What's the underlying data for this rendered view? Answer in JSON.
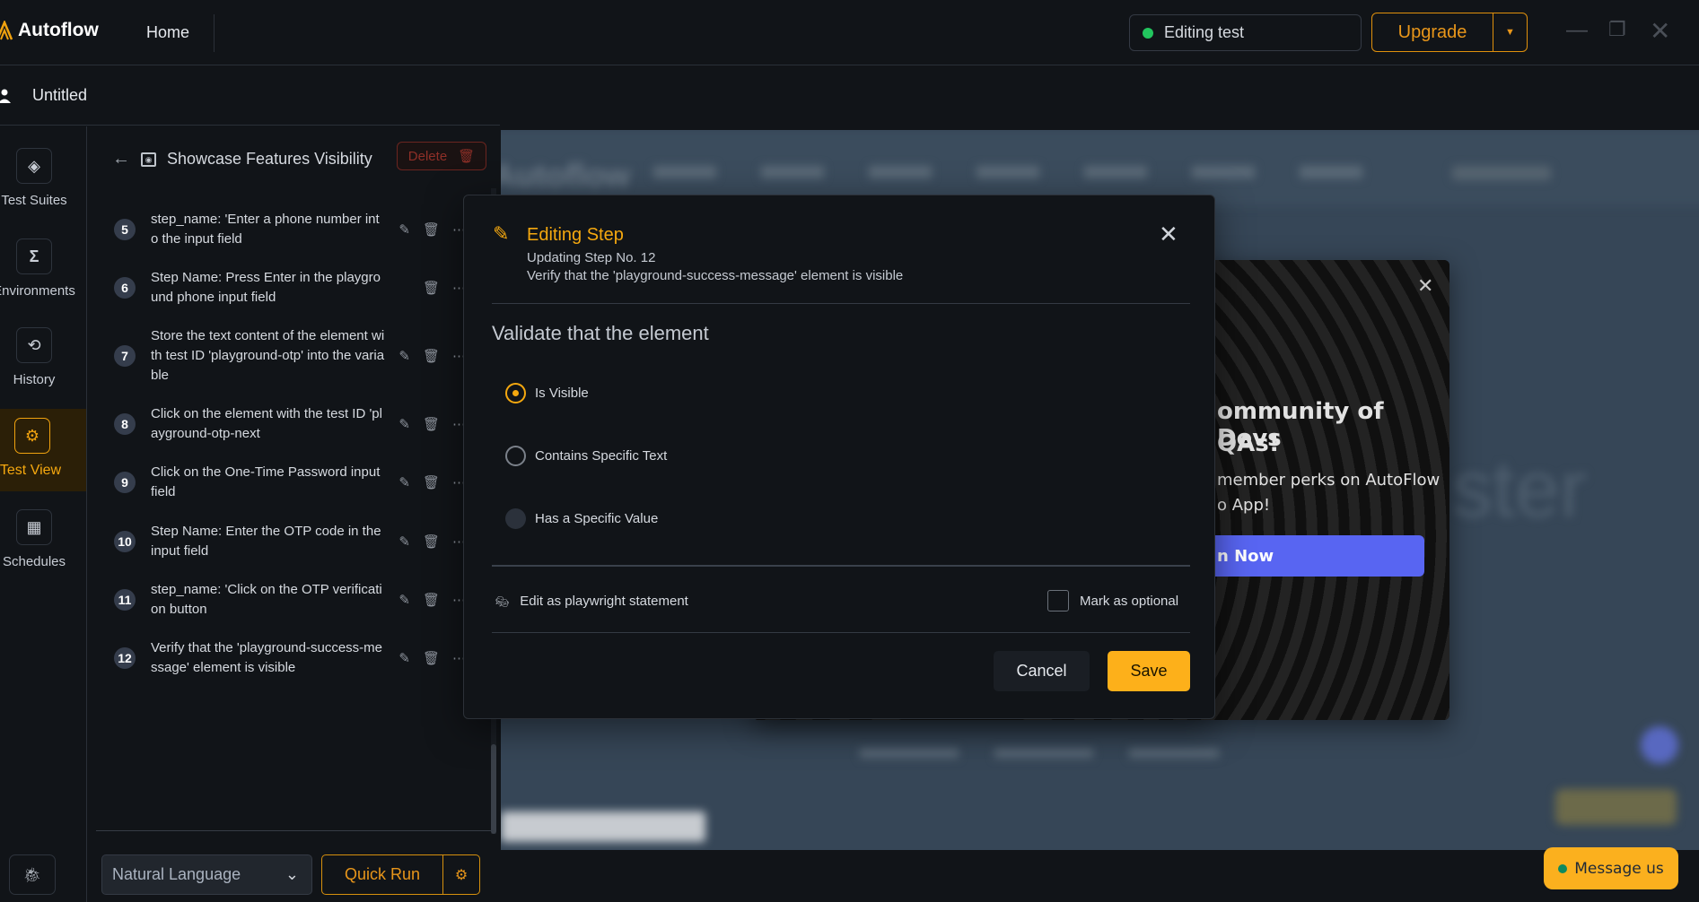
{
  "app": {
    "name": "Autoflow",
    "home": "Home",
    "status": "Editing test",
    "upgrade": "Upgrade"
  },
  "left_header": {
    "title": "Untitled"
  },
  "rail": [
    {
      "label": "Test Suites",
      "icon": "layers-icon"
    },
    {
      "label": "Environments",
      "icon": "sigma-icon"
    },
    {
      "label": "History",
      "icon": "history-icon"
    },
    {
      "label": "Test View",
      "icon": "gear-icon",
      "active": true
    },
    {
      "label": "Schedules",
      "icon": "calendar-icon"
    }
  ],
  "panel": {
    "title": "Showcase Features Visibility",
    "delete": "Delete"
  },
  "steps": [
    {
      "n": "5",
      "text": "step_name: 'Enter a phone number into the input field",
      "editable": true
    },
    {
      "n": "6",
      "text": "Step Name: Press Enter in the playground phone input field",
      "editable": false
    },
    {
      "n": "7",
      "text": "Store the text content of the element with test ID 'playground-otp' into the variable",
      "editable": true
    },
    {
      "n": "8",
      "text": "Click on the element with the test ID 'playground-otp-next",
      "editable": true
    },
    {
      "n": "9",
      "text": "Click on the One-Time Password input field",
      "editable": true
    },
    {
      "n": "10",
      "text": "Step Name: Enter the OTP code in the input field",
      "editable": true
    },
    {
      "n": "11",
      "text": "step_name: 'Click on the OTP verification button",
      "editable": true
    },
    {
      "n": "12",
      "text": "Verify that the 'playground-success-message' element is visible",
      "editable": true
    }
  ],
  "bottom": {
    "mode": "Natural Language",
    "quick_run": "Quick Run"
  },
  "modal": {
    "title": "Editing Step",
    "subtitle": "Updating Step No. 12",
    "description": "Verify that the 'playground-success-message' element is visible",
    "section": "Validate that the element",
    "options": [
      {
        "label": "Is Visible",
        "state": "selected"
      },
      {
        "label": "Contains Specific Text",
        "state": "unselected"
      },
      {
        "label": "Has a Specific Value",
        "state": "disabled"
      }
    ],
    "edit_playwright": "Edit as playwright statement",
    "mark_optional": "Mark as optional",
    "mark_optional_checked": false,
    "cancel": "Cancel",
    "save": "Save"
  },
  "promo": {
    "line1": "ommunity of Devs",
    "line2": "QAs!",
    "line3": "member perks on AutoFlow",
    "line4": "o App!",
    "button": "n Now"
  },
  "preview": {
    "logo": "Autoflow",
    "hero_fragment": "ster"
  },
  "chat": {
    "label": "Message us"
  },
  "colors": {
    "accent": "#f5a80f",
    "save": "#fdb01a",
    "danger": "#8e2f27",
    "promo_button": "#5865f2",
    "status_dot": "#22c55e"
  }
}
